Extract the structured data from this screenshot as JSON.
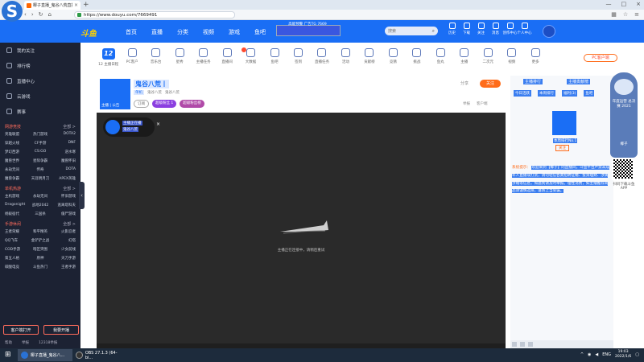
{
  "browser": {
    "tab_title": "椰子直播_鬼谷八荒直播...",
    "url": "https://www.douyu.com/7669491"
  },
  "header": {
    "logo": "斗鱼",
    "nav": [
      "首页",
      "直播",
      "分类",
      "视频",
      "游戏",
      "鱼吧"
    ],
    "promo": "高能预警 广告TG 7669",
    "search_placeholder": "搜索",
    "icons": [
      "历史",
      "下载",
      "关注",
      "消息",
      "创作中心",
      "个人中心"
    ]
  },
  "sidebar": {
    "top_items": [
      "我的关注",
      "排行榜",
      "直播中心",
      "云游戏",
      "赛事"
    ],
    "sections": [
      {
        "title": "网游竞技",
        "more": "全部 >",
        "items": [
          "英雄联盟",
          "热门游戏",
          "DOTA2",
          "穿越火线",
          "CF手游",
          "DNF",
          "梦幻西游",
          "CS:GO",
          "逆水寒",
          "魔兽世界",
          "星际争霸",
          "魔兽怀旧",
          "永劫无间",
          "传奇",
          "DOTA",
          "魔兽争霸",
          "天涯明月刀",
          "APEX英雄"
        ]
      },
      {
        "title": "单机热游",
        "more": "全部 >",
        "items": [
          "主机游戏",
          "永劫无间",
          "怀旧游戏",
          "Dragonight",
          "战地2042",
          "逃离塔科夫",
          "杨毅宿代",
          "三国杀",
          "僵尸游戏"
        ]
      },
      {
        "title": "手游休闲",
        "more": "全部 >",
        "items": [
          "王者荣耀",
          "和平精英",
          "火影忍者",
          "QQ飞车",
          "金铲铲之战",
          "幻塔",
          "COD手游",
          "暗区突围",
          "少女前线",
          "第五人格",
          "原神",
          "天刀手游",
          "碳酸电竞",
          "斗鱼热门",
          "王者手游"
        ]
      }
    ],
    "bottom_buttons": [
      "客户端打开",
      "我要开播"
    ],
    "footer": [
      "帮助",
      "举报",
      "12318举报"
    ]
  },
  "categories": [
    "12 主播日程",
    "PC客户",
    "音乐台",
    "星秀",
    "主播任务",
    "直播间",
    "大数据",
    "鱼吧",
    "签到",
    "直播任务",
    "活动",
    "贡献榜",
    "竞猜",
    "挑战",
    "鱼丸",
    "主播",
    "二次元",
    "视频",
    "更多"
  ],
  "pc_client": "PC客户端",
  "room": {
    "title": "鬼谷八荒丨",
    "meta": [
      "单机",
      "鬼谷八荒",
      "鬼谷八荒"
    ],
    "tags": [
      "订阅",
      "超级粉丝 1",
      "超级粉丝榜"
    ],
    "follow_label": "关注",
    "share_label": "分享",
    "report": [
      "举报",
      "客户端"
    ],
    "avatar_caption": "主播 | 公告"
  },
  "player": {
    "anchor_name": "主播正在播",
    "anchor_sub": "鬼谷八荒",
    "loading_text": "主播正在连接中，请稍后重试"
  },
  "right_panel": {
    "tabs": [
      "主播排行",
      "主播贡献榜"
    ],
    "subtabs": [
      "今日活跃",
      "本周排行",
      "福利(3)",
      "鱼吧"
    ],
    "rank_name": "本周排行No.1",
    "rank_btn": "关注",
    "announce_label": "系统提示：",
    "announce": "欢迎来到【椰子】的直播间，斗鱼平台严禁未成年人直播或打赏，请勿轻信各类招聘征婚、投资理财、涉黄涉赌等信息，如遇到请及时举报。理性消费，如主播推荐商品请谨慎选择，谨防上当受骗。"
  },
  "mascot": {
    "text": "年度运营 总决赛 2021",
    "name": "椰子",
    "qr_caption": "扫码下载斗鱼APP"
  },
  "taskbar": {
    "items": [
      "椰子直播_鬼谷八...",
      "OBS 27.1.3 (64-bi..."
    ],
    "lang": "ENG",
    "time": "19:03",
    "date": "2022/1/6"
  }
}
